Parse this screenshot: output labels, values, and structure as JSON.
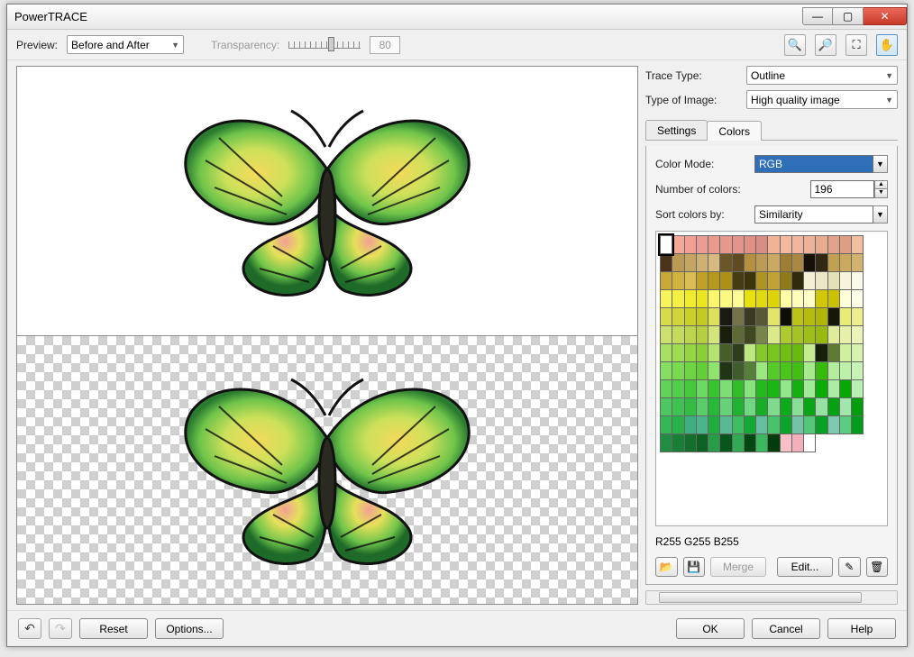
{
  "title": "PowerTRACE",
  "toolbar": {
    "previewLabel": "Preview:",
    "previewMode": "Before and After",
    "transparencyLabel": "Transparency:",
    "transparencyValue": "80"
  },
  "right": {
    "traceTypeLabel": "Trace Type:",
    "traceType": "Outline",
    "typeOfImageLabel": "Type of Image:",
    "typeOfImage": "High quality image",
    "tabs": {
      "settings": "Settings",
      "colors": "Colors"
    },
    "colorModeLabel": "Color Mode:",
    "colorMode": "RGB",
    "numColorsLabel": "Number of colors:",
    "numColors": "196",
    "sortByLabel": "Sort colors by:",
    "sortBy": "Similarity",
    "colorInfo": "R255 G255 B255",
    "buttons": {
      "merge": "Merge",
      "edit": "Edit..."
    }
  },
  "footer": {
    "reset": "Reset",
    "options": "Options...",
    "ok": "OK",
    "cancel": "Cancel",
    "help": "Help"
  },
  "palette": [
    [
      "#ffffff",
      "#f5a89a",
      "#f2a095",
      "#eb9c94",
      "#e99a8f",
      "#e5998c",
      "#e29488",
      "#df9186",
      "#da8d82",
      "#f0b396",
      "#f3ba9f",
      "#f1b79c",
      "#edb298",
      "#e8ac91",
      "#e2a389",
      "#dd9e84",
      "#f2bfa0"
    ],
    [
      "#4a3417",
      "#bb9a55",
      "#c4a663",
      "#cdb072",
      "#d6ba82",
      "#6b5629",
      "#5e4b22",
      "#b59043",
      "#be9b52",
      "#c9a862",
      "#9e7d37",
      "#a98842",
      "#171008",
      "#322712",
      "#c1a04f",
      "#caa95e",
      "#d2b26c"
    ],
    [
      "#c8a933",
      "#d1b241",
      "#dabc52",
      "#bfa126",
      "#b6981e",
      "#ae9017",
      "#453c0f",
      "#3c340c",
      "#b09423",
      "#c0a334",
      "#8f7a1a",
      "#312a0a",
      "#f3f0d6",
      "#ece7c5",
      "#e6e0b6",
      "#f7f4de",
      "#fbf9ea"
    ],
    [
      "#f7f45a",
      "#f4f044",
      "#f0eb2e",
      "#ece61d",
      "#faf76e",
      "#fcf982",
      "#fdfb95",
      "#e8e111",
      "#e2da0c",
      "#dcd308",
      "#fefca8",
      "#fefdbb",
      "#fefdc7",
      "#d0c705",
      "#cac103",
      "#fefed9",
      "#fefee9"
    ],
    [
      "#d7db4a",
      "#d0d53a",
      "#cacf2c",
      "#c3c920",
      "#dde05a",
      "#1a1a10",
      "#737249",
      "#3a3a24",
      "#585838",
      "#e2e569",
      "#0e0e09",
      "#bdc316",
      "#b6bc0e",
      "#b0b608",
      "#171709",
      "#e8ea7a",
      "#edee8b"
    ],
    [
      "#cde06e",
      "#c5db5e",
      "#bdd54e",
      "#b5cf3f",
      "#d4e47d",
      "#191f0c",
      "#5e6a35",
      "#40481f",
      "#77854a",
      "#dbe88c",
      "#adca31",
      "#a5c424",
      "#9ebf19",
      "#97b910",
      "#e1ec9b",
      "#e7f0aa",
      "#edf4ba"
    ],
    [
      "#a9e063",
      "#9fdb53",
      "#95d544",
      "#8bcf36",
      "#b3e472",
      "#485e28",
      "#2f3e1a",
      "#bce881",
      "#82ca29",
      "#79c51e",
      "#70bf14",
      "#68ba0c",
      "#c5ec90",
      "#172008",
      "#5f7a33",
      "#cef09f",
      "#d7f3ae"
    ],
    [
      "#85df61",
      "#79da52",
      "#6dd443",
      "#61cf35",
      "#91e370",
      "#203514",
      "#3e5d2a",
      "#568039",
      "#9ce77f",
      "#56ca28",
      "#4bc51c",
      "#41bf12",
      "#a7ea8d",
      "#38ba0a",
      "#b2ed9b",
      "#bdf0a9",
      "#c8f3b7"
    ],
    [
      "#5fd458",
      "#51ce4a",
      "#44c93c",
      "#6dd965",
      "#38c430",
      "#7ade73",
      "#2dbf25",
      "#87e280",
      "#23ba1c",
      "#1ab614",
      "#94e68d",
      "#12b10d",
      "#a0ea9a",
      "#0bad08",
      "#aceda6",
      "#06a904",
      "#b7f0b2"
    ],
    [
      "#4cc85e",
      "#3fc251",
      "#33bd45",
      "#59cd6a",
      "#28b83a",
      "#66d176",
      "#1eb330",
      "#72d682",
      "#15ae26",
      "#7fda8d",
      "#0eaa1e",
      "#8bde98",
      "#08a617",
      "#97e2a3",
      "#04a211",
      "#a2e6ad",
      "#019e0c"
    ],
    [
      "#32b956",
      "#27b34a",
      "#3eaf82",
      "#4bb48c",
      "#1dae3f",
      "#58b995",
      "#3dbe61",
      "#14a935",
      "#65be9e",
      "#48c36c",
      "#0ca42c",
      "#72c3a7",
      "#52c877",
      "#06a024",
      "#7fc8b0",
      "#5dcc81",
      "#029c1c"
    ],
    [
      "#218d40",
      "#197e36",
      "#12702c",
      "#0c6223",
      "#299c4a",
      "#07551b",
      "#31aa54",
      "#034813",
      "#3ab85e",
      "#013c0d",
      "#f7bfc7",
      "#f4b0ba",
      "#ffffff",
      "",
      "",
      "",
      ""
    ]
  ]
}
